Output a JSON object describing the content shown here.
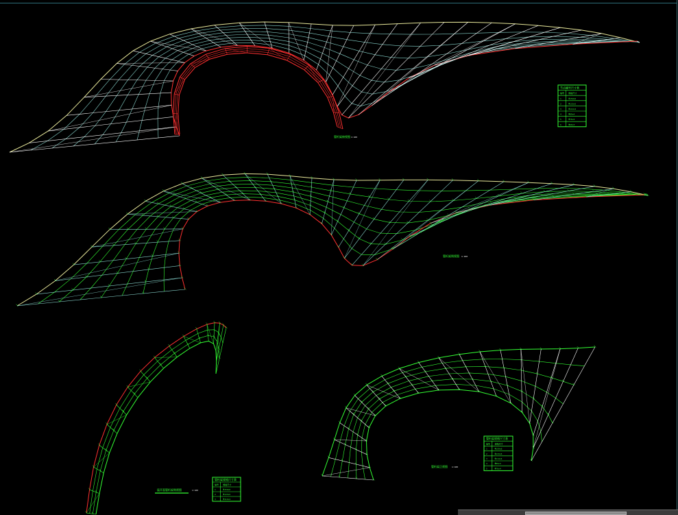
{
  "drawings": [
    {
      "caption": "管桁架俯视图",
      "scale": "1:100",
      "table": {
        "title": "节点编号尺寸表",
        "header": [
          "编号",
          "规格尺寸"
        ],
        "rows": [
          [
            "1",
            "Φ159x6"
          ],
          [
            "2",
            "Φ133x5"
          ],
          [
            "3",
            "Φ114x4"
          ],
          [
            "4",
            "Φ89x4"
          ],
          [
            "5",
            "Φ76x4"
          ],
          [
            "6",
            "Φ60x3"
          ]
        ]
      }
    },
    {
      "caption": "管桁架侧视图",
      "scale": "1:100"
    },
    {
      "caption": "展开面管桁架侧视图",
      "scale": "1:100",
      "table": {
        "title": "管桁架规格尺寸表",
        "header": [
          "编号",
          "规格尺寸"
        ],
        "rows": [
          [
            "1",
            "Φ159x6"
          ],
          [
            "2",
            "Φ133x5"
          ],
          [
            "3",
            "Φ114x4"
          ]
        ]
      }
    },
    {
      "caption": "管桁架正视图",
      "scale": "1:100",
      "table": {
        "title": "管桁架规格尺寸表",
        "header": [
          "编号",
          "规格尺寸"
        ],
        "rows": [
          [
            "1",
            "Φ159x6"
          ],
          [
            "2",
            "Φ133x5"
          ],
          [
            "3",
            "Φ114x4"
          ],
          [
            "4",
            "Φ89x4"
          ],
          [
            "5",
            "Φ76x4"
          ]
        ]
      }
    }
  ],
  "colors": {
    "wire_yellow": "#e8e89a",
    "wire_green": "#33ff33",
    "wire_red": "#ff3030",
    "wire_cyan": "#8ad8d0",
    "wire_white": "#ffffff",
    "background": "#000000"
  }
}
